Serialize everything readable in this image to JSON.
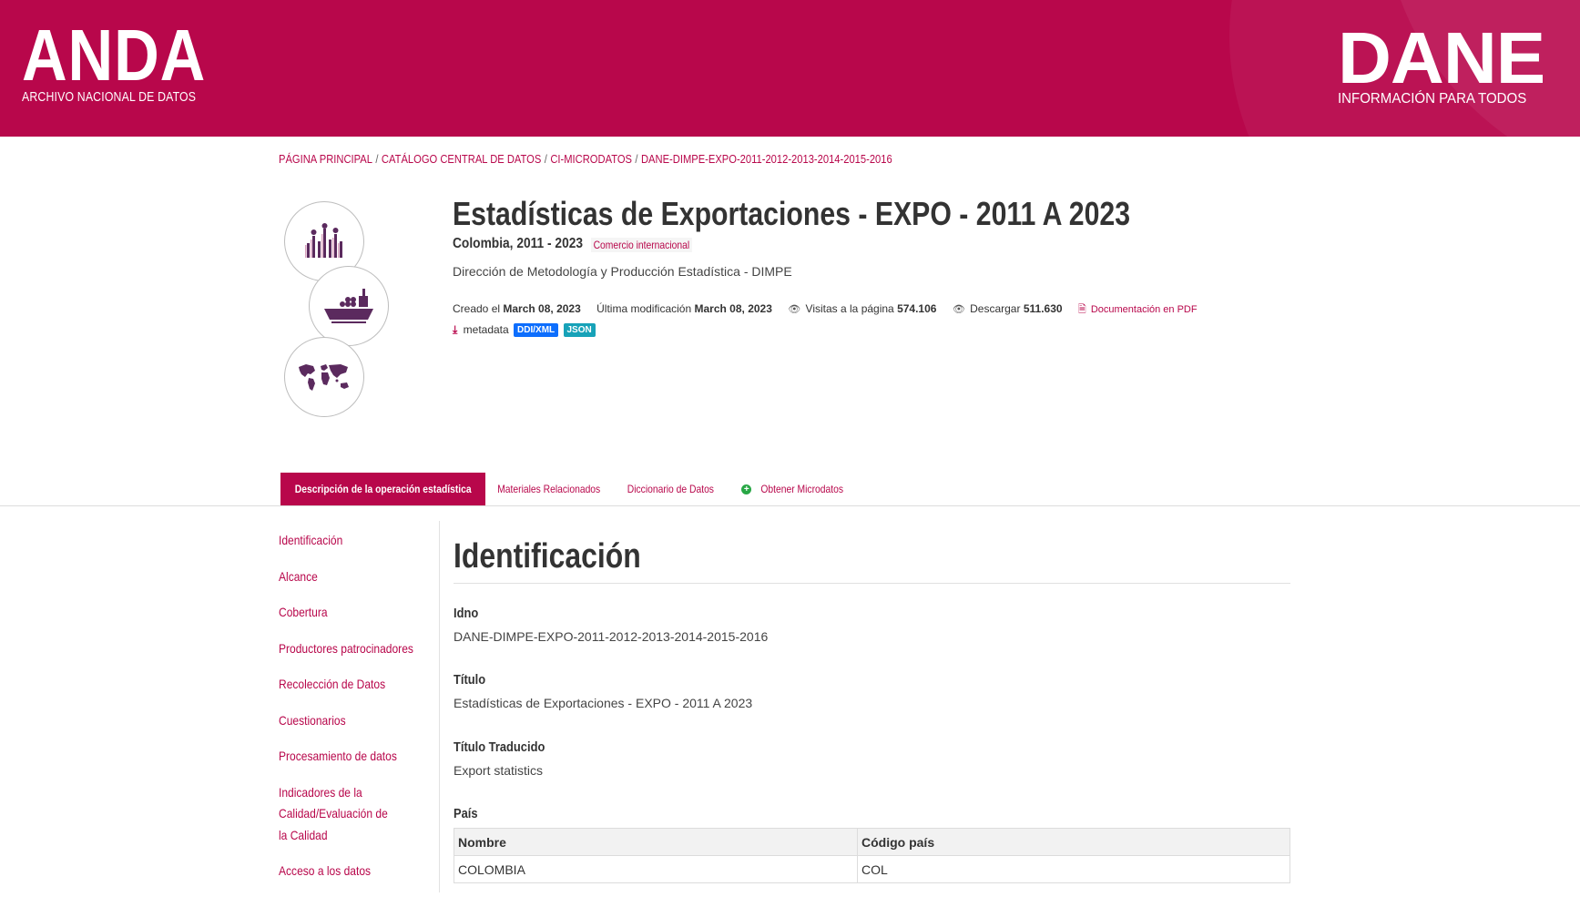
{
  "header": {
    "anda_title": "ANDA",
    "anda_subtitle": "ARCHIVO NACIONAL DE DATOS",
    "dane_title": "DANE",
    "dane_subtitle": "INFORMACIÓN PARA TODOS"
  },
  "breadcrumb": [
    "PÁGINA PRINCIPAL",
    "CATÁLOGO CENTRAL DE DATOS",
    "CI-MICRODATOS",
    "DANE-DIMPE-EXPO-2011-2012-2013-2014-2015-2016"
  ],
  "study": {
    "title": "Estadísticas de Exportaciones - EXPO - 2011 A 2023",
    "place_years": "Colombia, 2011 - 2023",
    "tag": "Comercio internacional",
    "producer": "Dirección de Metodología y Producción Estadística - DIMPE",
    "created_label": "Creado el",
    "created_value": "March 08, 2023",
    "modified_label": "Última modificación",
    "modified_value": "March 08, 2023",
    "visits_label": "Visitas a la página",
    "visits_value": "574.106",
    "downloads_label": "Descargar",
    "downloads_value": "511.630",
    "pdf_label": "Documentación en PDF",
    "metadata_label": "metadata",
    "badge_ddi": "DDI/XML",
    "badge_json": "JSON"
  },
  "tabs": [
    "Descripción de la operación estadística",
    "Materiales Relacionados",
    "Diccionario de Datos",
    "Obtener Microdatos"
  ],
  "sidebar": [
    "Identificación",
    "Alcance",
    "Cobertura",
    "Productores patrocinadores",
    "Recolección de Datos",
    "Cuestionarios",
    "Procesamiento de datos",
    "Indicadores de la Calidad/Evaluación de la Calidad",
    "Acceso a los datos"
  ],
  "section": {
    "title": "Identificación",
    "idno_label": "Idno",
    "idno_value": "DANE-DIMPE-EXPO-2011-2012-2013-2014-2015-2016",
    "titulo_label": "Título",
    "titulo_value": "Estadísticas de Exportaciones - EXPO - 2011 A 2023",
    "traducido_label": "Título Traducido",
    "traducido_value": "Export statistics",
    "pais_label": "País",
    "table": {
      "headers": [
        "Nombre",
        "Código país"
      ],
      "rows": [
        [
          "COLOMBIA",
          "COL"
        ]
      ]
    }
  },
  "colors": {
    "brand": "#b8074b",
    "badge_ddi": "#0d6efd",
    "badge_json": "#17a2b8",
    "icon_purple": "#5b2a5e"
  }
}
